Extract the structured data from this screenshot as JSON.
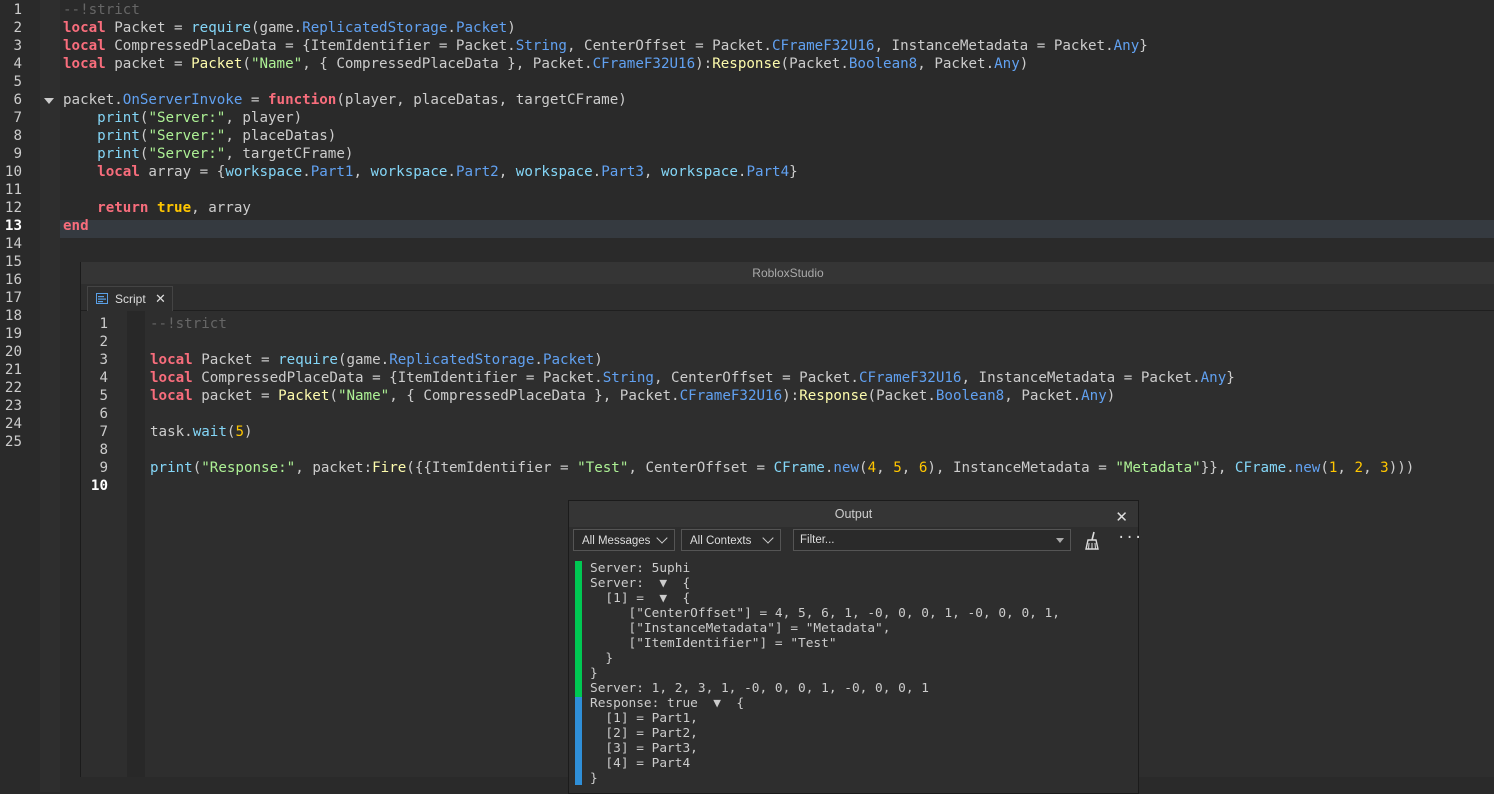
{
  "background_editor": {
    "line_numbers": [
      "1",
      "2",
      "3",
      "4",
      "5",
      "6",
      "7",
      "8",
      "9",
      "10",
      "11",
      "12",
      "13",
      "14",
      "15",
      "16",
      "17",
      "18",
      "19",
      "20",
      "21",
      "22",
      "23",
      "24",
      "25"
    ],
    "active_line": "13",
    "lines": [
      [
        {
          "t": "--!strict",
          "c": "cm"
        }
      ],
      [
        {
          "t": "local",
          "c": "kw"
        },
        {
          "t": " Packet = ",
          "c": "txt"
        },
        {
          "t": "require",
          "c": "bi"
        },
        {
          "t": "(game.",
          "c": "txt"
        },
        {
          "t": "ReplicatedStorage",
          "c": "prop"
        },
        {
          "t": ".",
          "c": "txt"
        },
        {
          "t": "Packet",
          "c": "prop"
        },
        {
          "t": ")",
          "c": "txt"
        }
      ],
      [
        {
          "t": "local",
          "c": "kw"
        },
        {
          "t": " CompressedPlaceData = {ItemIdentifier = Packet.",
          "c": "txt"
        },
        {
          "t": "String",
          "c": "prop"
        },
        {
          "t": ", CenterOffset = Packet.",
          "c": "txt"
        },
        {
          "t": "CFrameF32U16",
          "c": "prop"
        },
        {
          "t": ", InstanceMetadata = Packet.",
          "c": "txt"
        },
        {
          "t": "Any",
          "c": "prop"
        },
        {
          "t": "}",
          "c": "txt"
        }
      ],
      [
        {
          "t": "local",
          "c": "kw"
        },
        {
          "t": " packet = ",
          "c": "txt"
        },
        {
          "t": "Packet",
          "c": "fn"
        },
        {
          "t": "(",
          "c": "txt"
        },
        {
          "t": "\"Name\"",
          "c": "str"
        },
        {
          "t": ", { CompressedPlaceData }, Packet.",
          "c": "txt"
        },
        {
          "t": "CFrameF32U16",
          "c": "prop"
        },
        {
          "t": "):",
          "c": "txt"
        },
        {
          "t": "Response",
          "c": "fn"
        },
        {
          "t": "(Packet.",
          "c": "txt"
        },
        {
          "t": "Boolean8",
          "c": "prop"
        },
        {
          "t": ", Packet.",
          "c": "txt"
        },
        {
          "t": "Any",
          "c": "prop"
        },
        {
          "t": ")",
          "c": "txt"
        }
      ],
      [],
      [
        {
          "t": "packet.",
          "c": "txt"
        },
        {
          "t": "OnServerInvoke",
          "c": "prop"
        },
        {
          "t": " = ",
          "c": "txt"
        },
        {
          "t": "function",
          "c": "kw"
        },
        {
          "t": "(player, placeDatas, targetCFrame)",
          "c": "txt"
        }
      ],
      [
        {
          "t": "    ",
          "c": "txt"
        },
        {
          "t": "print",
          "c": "bi"
        },
        {
          "t": "(",
          "c": "txt"
        },
        {
          "t": "\"Server:\"",
          "c": "str"
        },
        {
          "t": ", player)",
          "c": "txt"
        }
      ],
      [
        {
          "t": "    ",
          "c": "txt"
        },
        {
          "t": "print",
          "c": "bi"
        },
        {
          "t": "(",
          "c": "txt"
        },
        {
          "t": "\"Server:\"",
          "c": "str"
        },
        {
          "t": ", placeDatas)",
          "c": "txt"
        }
      ],
      [
        {
          "t": "    ",
          "c": "txt"
        },
        {
          "t": "print",
          "c": "bi"
        },
        {
          "t": "(",
          "c": "txt"
        },
        {
          "t": "\"Server:\"",
          "c": "str"
        },
        {
          "t": ", targetCFrame)",
          "c": "txt"
        }
      ],
      [
        {
          "t": "    ",
          "c": "txt"
        },
        {
          "t": "local",
          "c": "kw"
        },
        {
          "t": " array = {",
          "c": "txt"
        },
        {
          "t": "workspace",
          "c": "bi"
        },
        {
          "t": ".",
          "c": "txt"
        },
        {
          "t": "Part1",
          "c": "prop"
        },
        {
          "t": ", ",
          "c": "txt"
        },
        {
          "t": "workspace",
          "c": "bi"
        },
        {
          "t": ".",
          "c": "txt"
        },
        {
          "t": "Part2",
          "c": "prop"
        },
        {
          "t": ", ",
          "c": "txt"
        },
        {
          "t": "workspace",
          "c": "bi"
        },
        {
          "t": ".",
          "c": "txt"
        },
        {
          "t": "Part3",
          "c": "prop"
        },
        {
          "t": ", ",
          "c": "txt"
        },
        {
          "t": "workspace",
          "c": "bi"
        },
        {
          "t": ".",
          "c": "txt"
        },
        {
          "t": "Part4",
          "c": "prop"
        },
        {
          "t": "}",
          "c": "txt"
        }
      ],
      [],
      [
        {
          "t": "    ",
          "c": "txt"
        },
        {
          "t": "return",
          "c": "kw"
        },
        {
          "t": " ",
          "c": "txt"
        },
        {
          "t": "true",
          "c": "bool"
        },
        {
          "t": ", array",
          "c": "txt"
        }
      ],
      [
        {
          "t": "end",
          "c": "kw"
        }
      ]
    ]
  },
  "studio": {
    "window_title": "RobloxStudio",
    "tab_label": "Script",
    "tab_close": "✕",
    "line_numbers": [
      "1",
      "2",
      "3",
      "4",
      "5",
      "6",
      "7",
      "8",
      "9",
      "10"
    ],
    "active_line": "10",
    "lines": [
      [
        {
          "t": "--!strict",
          "c": "cm"
        }
      ],
      [],
      [
        {
          "t": "local",
          "c": "kw"
        },
        {
          "t": " Packet = ",
          "c": "txt"
        },
        {
          "t": "require",
          "c": "bi"
        },
        {
          "t": "(game.",
          "c": "txt"
        },
        {
          "t": "ReplicatedStorage",
          "c": "prop"
        },
        {
          "t": ".",
          "c": "txt"
        },
        {
          "t": "Packet",
          "c": "prop"
        },
        {
          "t": ")",
          "c": "txt"
        }
      ],
      [
        {
          "t": "local",
          "c": "kw"
        },
        {
          "t": " CompressedPlaceData = {ItemIdentifier = Packet.",
          "c": "txt"
        },
        {
          "t": "String",
          "c": "prop"
        },
        {
          "t": ", CenterOffset = Packet.",
          "c": "txt"
        },
        {
          "t": "CFrameF32U16",
          "c": "prop"
        },
        {
          "t": ", InstanceMetadata = Packet.",
          "c": "txt"
        },
        {
          "t": "Any",
          "c": "prop"
        },
        {
          "t": "}",
          "c": "txt"
        }
      ],
      [
        {
          "t": "local",
          "c": "kw"
        },
        {
          "t": " packet = ",
          "c": "txt"
        },
        {
          "t": "Packet",
          "c": "fn"
        },
        {
          "t": "(",
          "c": "txt"
        },
        {
          "t": "\"Name\"",
          "c": "str"
        },
        {
          "t": ", { CompressedPlaceData }, Packet.",
          "c": "txt"
        },
        {
          "t": "CFrameF32U16",
          "c": "prop"
        },
        {
          "t": "):",
          "c": "txt"
        },
        {
          "t": "Response",
          "c": "fn"
        },
        {
          "t": "(Packet.",
          "c": "txt"
        },
        {
          "t": "Boolean8",
          "c": "prop"
        },
        {
          "t": ", Packet.",
          "c": "txt"
        },
        {
          "t": "Any",
          "c": "prop"
        },
        {
          "t": ")",
          "c": "txt"
        }
      ],
      [],
      [
        {
          "t": "task.",
          "c": "txt"
        },
        {
          "t": "wait",
          "c": "bi"
        },
        {
          "t": "(",
          "c": "txt"
        },
        {
          "t": "5",
          "c": "num"
        },
        {
          "t": ")",
          "c": "txt"
        }
      ],
      [],
      [
        {
          "t": "print",
          "c": "bi"
        },
        {
          "t": "(",
          "c": "txt"
        },
        {
          "t": "\"Response:\"",
          "c": "str"
        },
        {
          "t": ", packet:",
          "c": "txt"
        },
        {
          "t": "Fire",
          "c": "fn"
        },
        {
          "t": "({{ItemIdentifier = ",
          "c": "txt"
        },
        {
          "t": "\"Test\"",
          "c": "str"
        },
        {
          "t": ", CenterOffset = ",
          "c": "txt"
        },
        {
          "t": "CFrame",
          "c": "bi"
        },
        {
          "t": ".",
          "c": "txt"
        },
        {
          "t": "new",
          "c": "prop"
        },
        {
          "t": "(",
          "c": "txt"
        },
        {
          "t": "4",
          "c": "num"
        },
        {
          "t": ", ",
          "c": "txt"
        },
        {
          "t": "5",
          "c": "num"
        },
        {
          "t": ", ",
          "c": "txt"
        },
        {
          "t": "6",
          "c": "num"
        },
        {
          "t": "), InstanceMetadata = ",
          "c": "txt"
        },
        {
          "t": "\"Metadata\"",
          "c": "str"
        },
        {
          "t": "}}, ",
          "c": "txt"
        },
        {
          "t": "CFrame",
          "c": "bi"
        },
        {
          "t": ".",
          "c": "txt"
        },
        {
          "t": "new",
          "c": "prop"
        },
        {
          "t": "(",
          "c": "txt"
        },
        {
          "t": "1",
          "c": "num"
        },
        {
          "t": ", ",
          "c": "txt"
        },
        {
          "t": "2",
          "c": "num"
        },
        {
          "t": ", ",
          "c": "txt"
        },
        {
          "t": "3",
          "c": "num"
        },
        {
          "t": ")))",
          "c": "txt"
        }
      ],
      []
    ]
  },
  "output": {
    "title": "Output",
    "close": "✕",
    "messages_filter": "All Messages",
    "contexts_filter": "All Contexts",
    "filter_placeholder": "Filter...",
    "more": "···",
    "lines": [
      "Server: 5uphi",
      "Server:  ▼  {",
      "  [1] =  ▼  {",
      "     [\"CenterOffset\"] = 4, 5, 6, 1, -0, 0, 0, 1, -0, 0, 0, 1,",
      "     [\"InstanceMetadata\"] = \"Metadata\",",
      "     [\"ItemIdentifier\"] = \"Test\"",
      "  }",
      "}",
      "Server: 1, 2, 3, 1, -0, 0, 0, 1, -0, 0, 0, 1",
      "Response: true  ▼  {",
      "  [1] = Part1,",
      "  [2] = Part2,",
      "  [3] = Part3,",
      "  [4] = Part4",
      "}"
    ],
    "colors": {
      "server_bar": "#00c853",
      "response_bar": "#2f8fd8"
    }
  }
}
